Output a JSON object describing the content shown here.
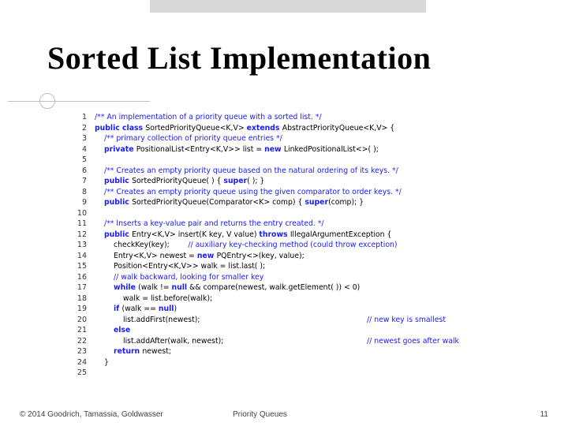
{
  "title": "Sorted List Implementation",
  "footer": {
    "copyright": "© 2014 Goodrich, Tamassia, Goldwasser",
    "center": "Priority Queues",
    "page": "11"
  },
  "code": [
    {
      "n": "1",
      "seg": [
        {
          "c": "cm",
          "t": "/** An implementation of a priority queue with a sorted list. */"
        }
      ]
    },
    {
      "n": "2",
      "seg": [
        {
          "c": "kw",
          "t": "public class "
        },
        {
          "c": "id",
          "t": "SortedPriorityQueue<K,V> "
        },
        {
          "c": "kw",
          "t": "extends "
        },
        {
          "c": "id",
          "t": "AbstractPriorityQueue<K,V> {"
        }
      ]
    },
    {
      "n": "3",
      "ind": 1,
      "seg": [
        {
          "c": "cm",
          "t": "/** primary collection of priority queue entries */"
        }
      ]
    },
    {
      "n": "4",
      "ind": 1,
      "seg": [
        {
          "c": "kw",
          "t": "private "
        },
        {
          "c": "id",
          "t": "PositionalList<Entry<K,V>> list = "
        },
        {
          "c": "kw",
          "t": "new "
        },
        {
          "c": "id",
          "t": "LinkedPositionalList<>( );"
        }
      ]
    },
    {
      "n": "5",
      "seg": []
    },
    {
      "n": "6",
      "ind": 1,
      "seg": [
        {
          "c": "cm",
          "t": "/** Creates an empty priority queue based on the natural ordering of its keys. */"
        }
      ]
    },
    {
      "n": "7",
      "ind": 1,
      "seg": [
        {
          "c": "kw",
          "t": "public "
        },
        {
          "c": "id",
          "t": "SortedPriorityQueue( ) { "
        },
        {
          "c": "kw",
          "t": "super"
        },
        {
          "c": "id",
          "t": "( ); }"
        }
      ]
    },
    {
      "n": "8",
      "ind": 1,
      "seg": [
        {
          "c": "cm",
          "t": "/** Creates an empty priority queue using the given comparator to order keys. */"
        }
      ]
    },
    {
      "n": "9",
      "ind": 1,
      "seg": [
        {
          "c": "kw",
          "t": "public "
        },
        {
          "c": "id",
          "t": "SortedPriorityQueue(Comparator<K> comp) { "
        },
        {
          "c": "kw",
          "t": "super"
        },
        {
          "c": "id",
          "t": "(comp); }"
        }
      ]
    },
    {
      "n": "10",
      "seg": []
    },
    {
      "n": "11",
      "ind": 1,
      "seg": [
        {
          "c": "cm",
          "t": "/** Inserts a key-value pair and returns the entry created. */"
        }
      ]
    },
    {
      "n": "12",
      "ind": 1,
      "seg": [
        {
          "c": "kw",
          "t": "public "
        },
        {
          "c": "id",
          "t": "Entry<K,V> insert(K key, V value) "
        },
        {
          "c": "kw",
          "t": "throws "
        },
        {
          "c": "id",
          "t": "IllegalArgumentException {"
        }
      ]
    },
    {
      "n": "13",
      "ind": 2,
      "seg": [
        {
          "c": "id",
          "t": "checkKey(key);        "
        },
        {
          "c": "cm",
          "t": "// auxiliary key-checking method (could throw exception)"
        }
      ]
    },
    {
      "n": "14",
      "ind": 2,
      "seg": [
        {
          "c": "id",
          "t": "Entry<K,V> newest = "
        },
        {
          "c": "kw",
          "t": "new "
        },
        {
          "c": "id",
          "t": "PQEntry<>(key, value);"
        }
      ]
    },
    {
      "n": "15",
      "ind": 2,
      "seg": [
        {
          "c": "id",
          "t": "Position<Entry<K,V>> walk = list.last( );"
        }
      ]
    },
    {
      "n": "16",
      "ind": 2,
      "seg": [
        {
          "c": "cm",
          "t": "// walk backward, looking for smaller key"
        }
      ]
    },
    {
      "n": "17",
      "ind": 2,
      "seg": [
        {
          "c": "kw",
          "t": "while "
        },
        {
          "c": "id",
          "t": "(walk != "
        },
        {
          "c": "kw",
          "t": "null"
        },
        {
          "c": "id",
          "t": " && compare(newest, walk.getElement( )) < 0)"
        }
      ]
    },
    {
      "n": "18",
      "ind": 3,
      "seg": [
        {
          "c": "id",
          "t": "walk = list.before(walk);"
        }
      ]
    },
    {
      "n": "19",
      "ind": 2,
      "seg": [
        {
          "c": "kw",
          "t": "if "
        },
        {
          "c": "id",
          "t": "(walk == "
        },
        {
          "c": "kw",
          "t": "null"
        },
        {
          "c": "id",
          "t": ")"
        }
      ]
    },
    {
      "n": "20",
      "ind": 3,
      "seg": [
        {
          "c": "id",
          "t": "list.addFirst(newest);"
        }
      ],
      "rc": "// new key is smallest"
    },
    {
      "n": "21",
      "ind": 2,
      "seg": [
        {
          "c": "kw",
          "t": "else"
        }
      ]
    },
    {
      "n": "22",
      "ind": 3,
      "seg": [
        {
          "c": "id",
          "t": "list.addAfter(walk, newest);"
        }
      ],
      "rc": "// newest goes after walk"
    },
    {
      "n": "23",
      "ind": 2,
      "seg": [
        {
          "c": "kw",
          "t": "return "
        },
        {
          "c": "id",
          "t": "newest;"
        }
      ]
    },
    {
      "n": "24",
      "ind": 1,
      "seg": [
        {
          "c": "id",
          "t": "}"
        }
      ]
    },
    {
      "n": "25",
      "seg": []
    }
  ]
}
